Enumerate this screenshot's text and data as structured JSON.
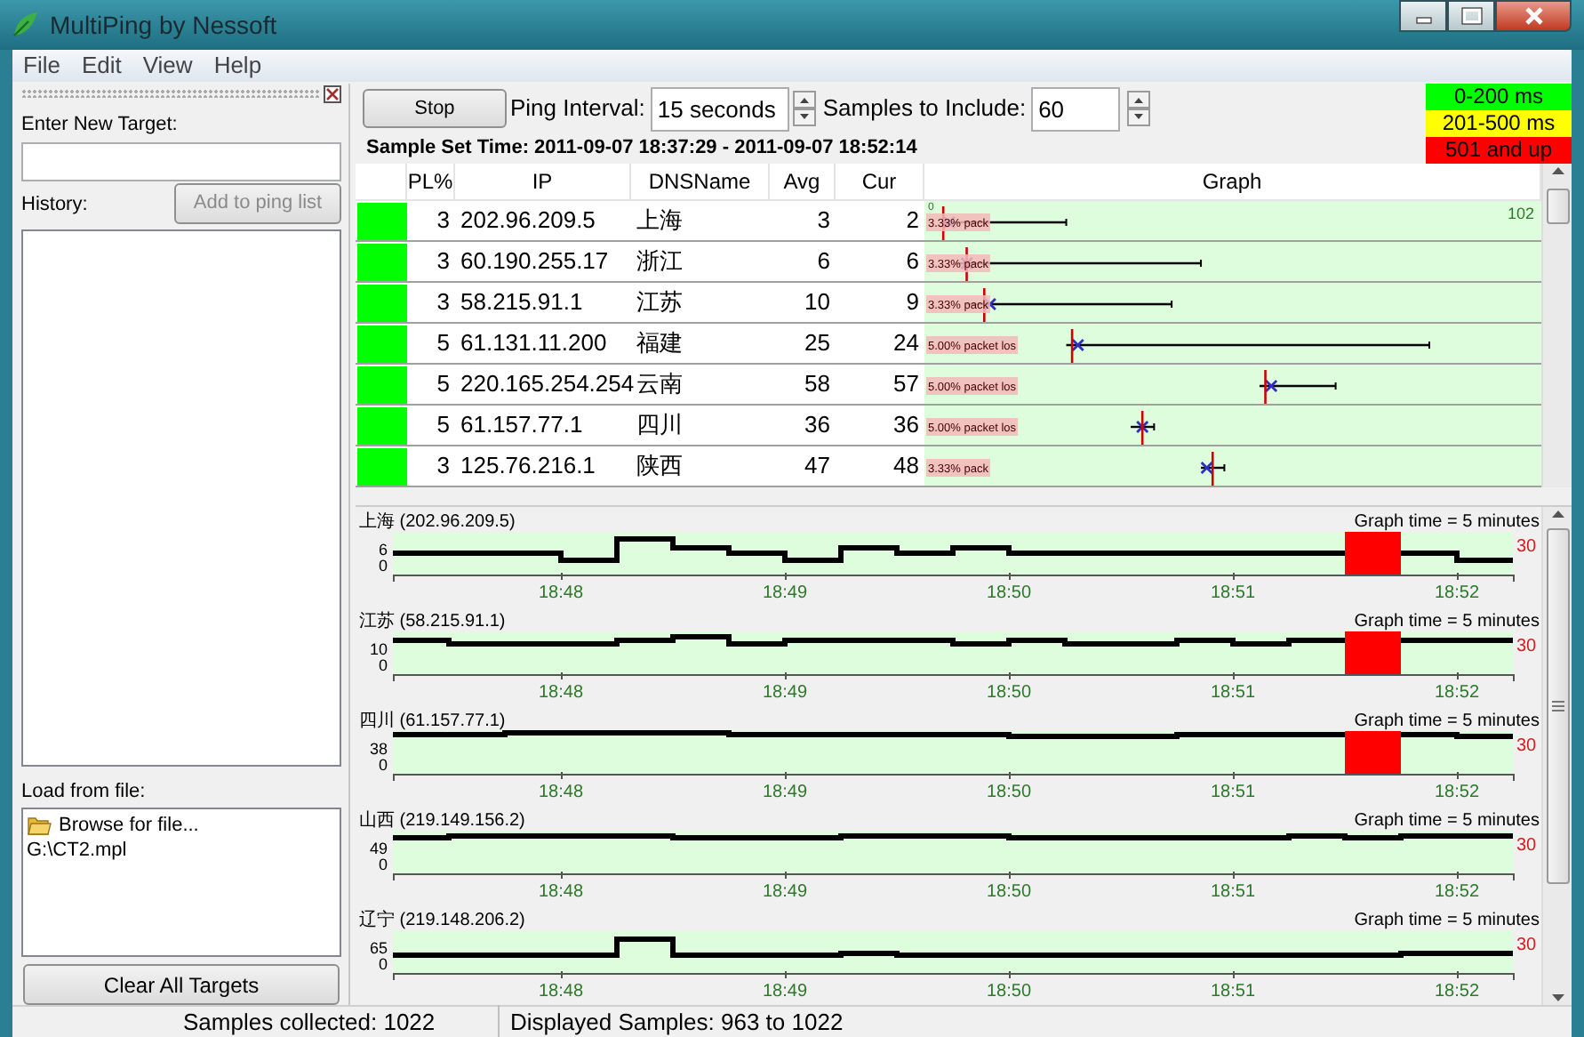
{
  "window": {
    "title": "MultiPing by Nessoft"
  },
  "menu": [
    "File",
    "Edit",
    "View",
    "Help"
  ],
  "left_panel": {
    "target_label": "Enter New Target:",
    "history_label": "History:",
    "add_button": {
      "label": "Add to ping list",
      "disabled": true
    },
    "load_label": "Load from file:",
    "file_items": [
      {
        "label": "Browse for file...",
        "kind": "browse"
      },
      {
        "label": "G:\\CT2.mpl",
        "kind": "file"
      }
    ],
    "clear_button": "Clear All Targets"
  },
  "toolbar": {
    "stop_button": "Stop",
    "interval_label": "Ping Interval:",
    "interval_value": "15 seconds",
    "samples_label": "Samples to Include:",
    "samples_value": "60",
    "sample_set_time": "Sample Set Time: 2011-09-07 18:37:29 - 2011-09-07 18:52:14"
  },
  "legend": [
    {
      "label": "0-200 ms",
      "color": "#00ff00"
    },
    {
      "label": "201-500 ms",
      "color": "#ffff00"
    },
    {
      "label": "501 and up",
      "color": "#ff0000"
    }
  ],
  "table": {
    "columns": [
      "PL%",
      "IP",
      "DNSName",
      "Avg",
      "Cur",
      "Graph"
    ],
    "graph_scale": [
      "0",
      "102"
    ],
    "rows": [
      {
        "color": "#00ff00",
        "pl": "3",
        "ip": "202.96.209.5",
        "dns": "上海",
        "avg": "3",
        "cur": "2",
        "graph_note": "3.33% pack"
      },
      {
        "color": "#00ff00",
        "pl": "3",
        "ip": "60.190.255.17",
        "dns": "浙江",
        "avg": "6",
        "cur": "6",
        "graph_note": "3.33% pack"
      },
      {
        "color": "#00ff00",
        "pl": "3",
        "ip": "58.215.91.1",
        "dns": "江苏",
        "avg": "10",
        "cur": "9",
        "graph_note": "3.33% pack"
      },
      {
        "color": "#00ff00",
        "pl": "5",
        "ip": "61.131.11.200",
        "dns": "福建",
        "avg": "25",
        "cur": "24",
        "graph_note": "5.00% packet los"
      },
      {
        "color": "#00ff00",
        "pl": "5",
        "ip": "220.165.254.254",
        "dns": "云南",
        "avg": "58",
        "cur": "57",
        "graph_note": "5.00% packet los"
      },
      {
        "color": "#00ff00",
        "pl": "5",
        "ip": "61.157.77.1",
        "dns": "四川",
        "avg": "36",
        "cur": "36",
        "graph_note": "5.00% packet los"
      },
      {
        "color": "#00ff00",
        "pl": "3",
        "ip": "125.76.216.1",
        "dns": "陕西",
        "avg": "47",
        "cur": "48",
        "graph_note": "3.33% pack"
      }
    ]
  },
  "charts": [
    {
      "title": "上海 (202.96.209.5)",
      "graph_time": "Graph time = 5 minutes",
      "right_label": "30",
      "y_labels": [
        "6",
        "0"
      ],
      "time_labels": [
        "18:48",
        "18:49",
        "18:50",
        "18:51",
        "18:52"
      ]
    },
    {
      "title": "江苏 (58.215.91.1)",
      "graph_time": "Graph time = 5 minutes",
      "right_label": "30",
      "y_labels": [
        "10",
        "0"
      ],
      "time_labels": [
        "18:48",
        "18:49",
        "18:50",
        "18:51",
        "18:52"
      ]
    },
    {
      "title": "四川 (61.157.77.1)",
      "graph_time": "Graph time = 5 minutes",
      "right_label": "30",
      "y_labels": [
        "38",
        "0"
      ],
      "time_labels": [
        "18:48",
        "18:49",
        "18:50",
        "18:51",
        "18:52"
      ]
    },
    {
      "title": "山西 (219.149.156.2)",
      "graph_time": "Graph time = 5 minutes",
      "right_label": "30",
      "y_labels": [
        "49",
        "0"
      ],
      "time_labels": [
        "18:48",
        "18:49",
        "18:50",
        "18:51",
        "18:52"
      ]
    },
    {
      "title": "辽宁 (219.148.206.2)",
      "graph_time": "Graph time = 5 minutes",
      "right_label": "30",
      "y_labels": [
        "65",
        "0"
      ],
      "time_labels": [
        "18:48",
        "18:49",
        "18:50",
        "18:51",
        "18:52"
      ]
    }
  ],
  "status_bar": [
    "Samples collected: 1022",
    "Displayed Samples: 963 to 1022"
  ]
}
